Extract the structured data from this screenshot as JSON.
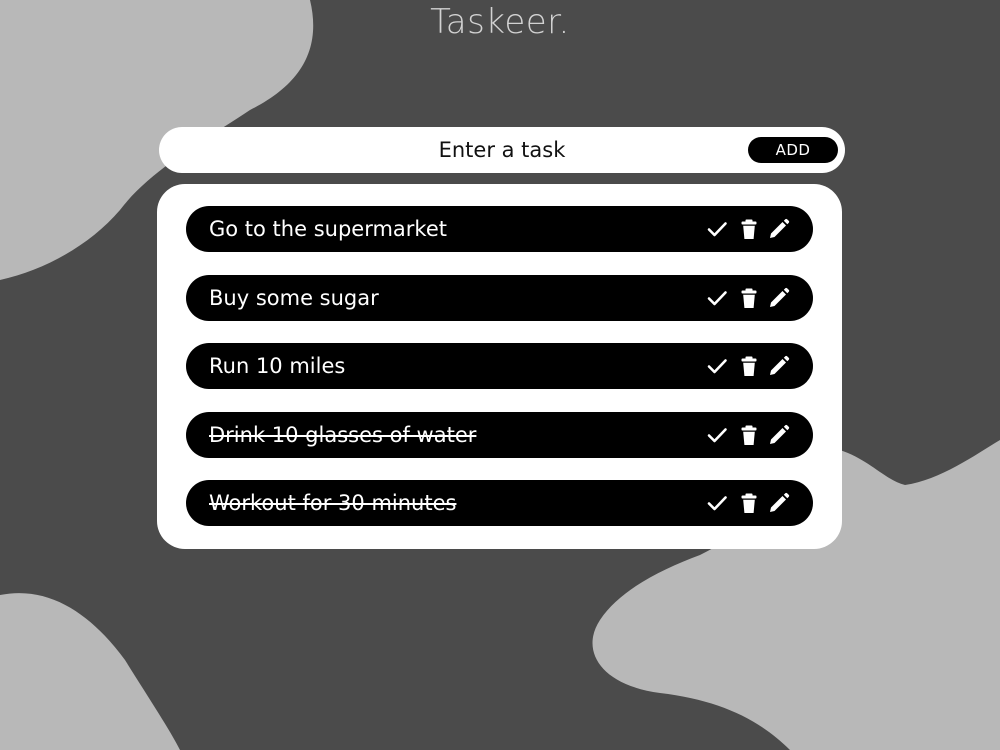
{
  "app": {
    "title": "Taskeer."
  },
  "input": {
    "placeholder": "Enter a task",
    "value": ""
  },
  "add_button": {
    "label": "ADD"
  },
  "tasks": [
    {
      "text": "Go to the supermarket",
      "completed": false
    },
    {
      "text": "Buy some sugar",
      "completed": false
    },
    {
      "text": "Run 10 miles",
      "completed": false
    },
    {
      "text": "Drink 10 glasses of water",
      "completed": true
    },
    {
      "text": "Workout for 30 minutes",
      "completed": true
    }
  ],
  "task_actions": {
    "complete_icon": "check-icon",
    "delete_icon": "trash-icon",
    "edit_icon": "pencil-icon"
  },
  "colors": {
    "background_dark": "#4b4b4b",
    "background_light": "#b8b8b8",
    "title": "#d2d2d2",
    "card": "#ffffff",
    "task_row": "#000000",
    "task_text": "#ffffff"
  }
}
